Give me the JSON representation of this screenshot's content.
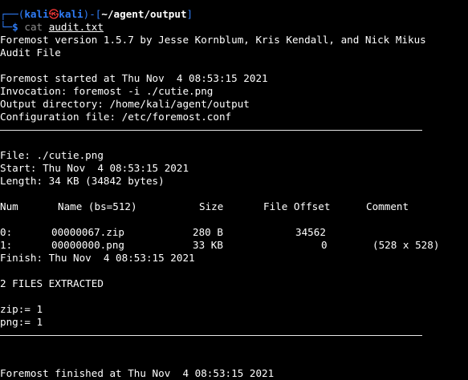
{
  "prompt": {
    "corner_top": "┌──(",
    "user": "kali",
    "at_symbol": "㉿",
    "host": "kali",
    "mid": ")-[",
    "path": "~/agent/output",
    "close": "]",
    "corner_bottom": "└─",
    "dollar": "$",
    "command": "cat",
    "argument": "audit.txt"
  },
  "header": {
    "version": "Foremost version 1.5.7 by Jesse Kornblum, Kris Kendall, and Nick Mikus",
    "title": "Audit File"
  },
  "run_info": {
    "started": "Foremost started at Thu Nov  4 08:53:15 2021",
    "invocation": "Invocation: foremost -i ./cutie.png",
    "output_dir": "Output directory: /home/kali/agent/output",
    "config": "Configuration file: /etc/foremost.conf"
  },
  "file_info": {
    "file": "File: ./cutie.png",
    "start": "Start: Thu Nov  4 08:53:15 2021",
    "length": "Length: 34 KB (34842 bytes)"
  },
  "table": {
    "headers": {
      "num": "Num",
      "name": "Name (bs=512)",
      "size": "Size",
      "offset": "File Offset",
      "comment": "Comment"
    },
    "rows": [
      {
        "num": "0:",
        "name": "00000067.zip",
        "size": "280 B",
        "offset": "34562",
        "comment": ""
      },
      {
        "num": "1:",
        "name": "00000000.png",
        "size": "33 KB",
        "offset": "0",
        "comment": "(528 x 528)"
      }
    ]
  },
  "summary": {
    "finish": "Finish: Thu Nov  4 08:53:15 2021",
    "extracted": "2 FILES EXTRACTED",
    "zip_count": "zip:= 1",
    "png_count": "png:= 1",
    "finished": "Foremost finished at Thu Nov  4 08:53:15 2021"
  },
  "colors": {
    "background": "#000000",
    "prompt_accent": "#2f7cf6",
    "prompt_symbol": "#ff3b3b",
    "text": "#ffffff"
  }
}
